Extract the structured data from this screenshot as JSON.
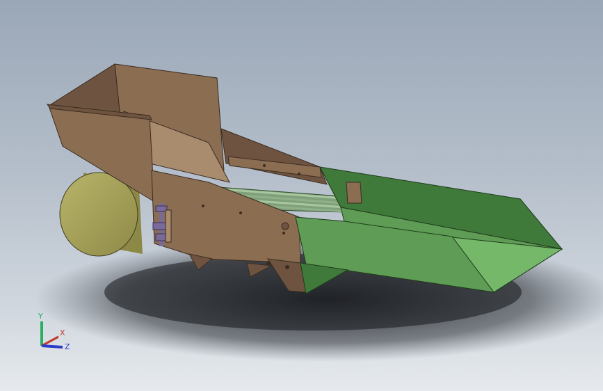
{
  "viewport": {
    "background_top": "#9aa7b7",
    "background_bottom": "#e6eaee"
  },
  "colors": {
    "hopper": "#8b6d52",
    "hopper_dark": "#6e5440",
    "hopper_light": "#a98b6e",
    "chute": "#5f9c55",
    "chute_light": "#76b86a",
    "chute_dark": "#3f7a3a",
    "drum": "#a9a55a",
    "drum_dark": "#8c8845",
    "rollers": "#7fa07a",
    "hardware": "#7a6a9a"
  },
  "triad": {
    "x_label": "X",
    "y_label": "Y",
    "z_label": "Z",
    "x_color": "#c0392b",
    "y_color": "#27ae60",
    "z_color": "#2c3ec7"
  }
}
